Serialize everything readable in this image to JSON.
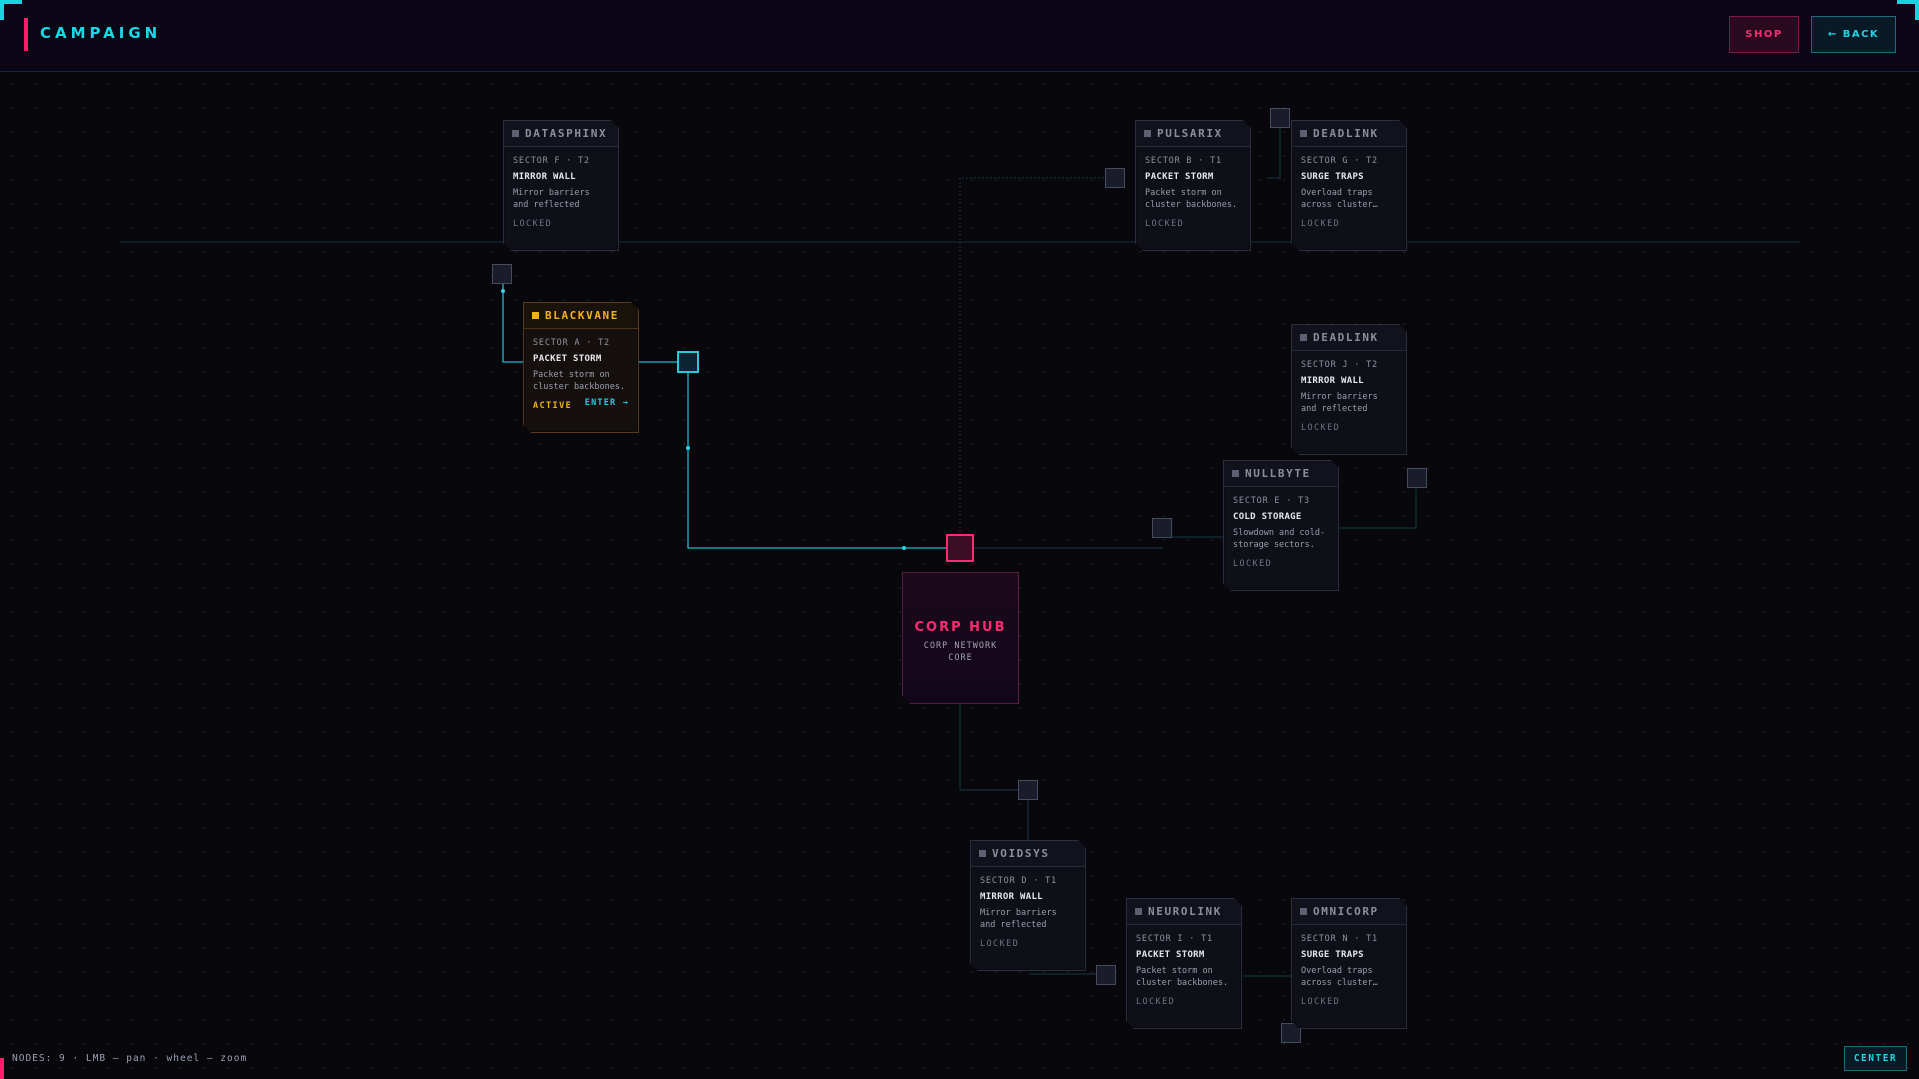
{
  "header": {
    "title": "CAMPAIGN",
    "shop_label": "SHOP",
    "back_label": "← BACK"
  },
  "hub": {
    "name": "CORP HUB",
    "subtitle": "CORP NETWORK CORE"
  },
  "nodes": [
    {
      "id": "datasphinx",
      "name": "DATASPHINX",
      "sector": "SECTOR F · T2",
      "modifier": "MIRROR WALL",
      "desc": "Mirror barriers and reflected attacks.",
      "status": "LOCKED"
    },
    {
      "id": "blackvane",
      "name": "BLACKVANE",
      "sector": "SECTOR A · T2",
      "modifier": "PACKET STORM",
      "desc": "Packet storm on cluster backbones.",
      "status": "ACTIVE",
      "enter": "ENTER →"
    },
    {
      "id": "pulsarix",
      "name": "PULSARIX",
      "sector": "SECTOR B · T1",
      "modifier": "PACKET STORM",
      "desc": "Packet storm on cluster backbones.",
      "status": "LOCKED"
    },
    {
      "id": "deadlink-g",
      "name": "DEADLINK",
      "sector": "SECTOR G · T2",
      "modifier": "SURGE TRAPS",
      "desc": "Overload traps across cluster…",
      "status": "LOCKED"
    },
    {
      "id": "deadlink-j",
      "name": "DEADLINK",
      "sector": "SECTOR J · T2",
      "modifier": "MIRROR WALL",
      "desc": "Mirror barriers and reflected attacks.",
      "status": "LOCKED"
    },
    {
      "id": "nullbyte",
      "name": "NULLBYTE",
      "sector": "SECTOR E · T3",
      "modifier": "COLD STORAGE",
      "desc": "Slowdown and cold-storage sectors.",
      "status": "LOCKED"
    },
    {
      "id": "voidsys",
      "name": "VOIDSYS",
      "sector": "SECTOR D · T1",
      "modifier": "MIRROR WALL",
      "desc": "Mirror barriers and reflected attacks.",
      "status": "LOCKED"
    },
    {
      "id": "neurolink",
      "name": "NEUROLINK",
      "sector": "SECTOR I · T1",
      "modifier": "PACKET STORM",
      "desc": "Packet storm on cluster backbones.",
      "status": "LOCKED"
    },
    {
      "id": "omnicorp",
      "name": "OMNICORP",
      "sector": "SECTOR N · T1",
      "modifier": "SURGE TRAPS",
      "desc": "Overload traps across cluster…",
      "status": "LOCKED"
    }
  ],
  "footer": {
    "hint": "NODES: 9 · LMB — pan · wheel — zoom",
    "center_label": "CENTER"
  },
  "colors": {
    "accent_cyan": "#18d8e8",
    "accent_pink": "#ff2a72",
    "active_amber": "#f5b21c",
    "background": "#07070c"
  }
}
